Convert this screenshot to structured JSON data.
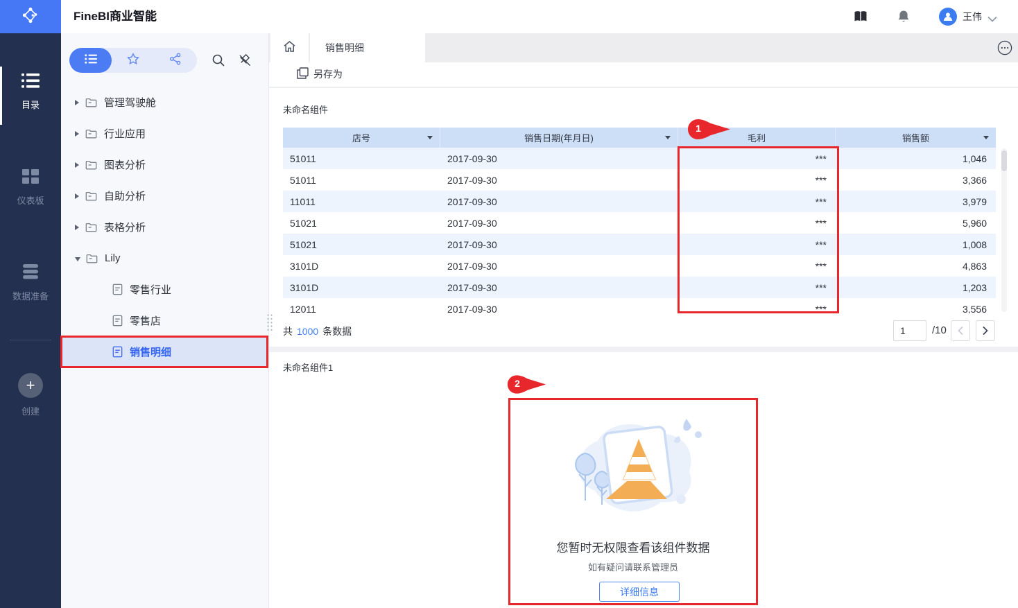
{
  "app": {
    "title": "FineBI商业智能",
    "user_name": "王伟"
  },
  "nav_rail": {
    "items": [
      {
        "label": "目录",
        "icon": "list-icon",
        "active": true
      },
      {
        "label": "仪表板",
        "icon": "dashboard-icon",
        "active": false
      },
      {
        "label": "数据准备",
        "icon": "database-icon",
        "active": false
      },
      {
        "label": "创建",
        "icon": "plus-icon",
        "active": false
      }
    ]
  },
  "sidebar": {
    "view_switch": [
      {
        "icon": "list-icon",
        "active": true
      },
      {
        "icon": "star-icon",
        "active": false
      },
      {
        "icon": "share-icon",
        "active": false
      }
    ],
    "tools": [
      {
        "icon": "search-icon"
      },
      {
        "icon": "unpin-icon"
      }
    ],
    "tree": [
      {
        "label": "管理驾驶舱",
        "type": "folder",
        "level": 0,
        "expanded": false,
        "selected": false
      },
      {
        "label": "行业应用",
        "type": "folder",
        "level": 0,
        "expanded": false,
        "selected": false
      },
      {
        "label": "图表分析",
        "type": "folder",
        "level": 0,
        "expanded": false,
        "selected": false
      },
      {
        "label": "自助分析",
        "type": "folder",
        "level": 0,
        "expanded": false,
        "selected": false
      },
      {
        "label": "表格分析",
        "type": "folder",
        "level": 0,
        "expanded": false,
        "selected": false
      },
      {
        "label": "Lily",
        "type": "folder",
        "level": 0,
        "expanded": true,
        "selected": false
      },
      {
        "label": "零售行业",
        "type": "doc",
        "level": 1,
        "expanded": false,
        "selected": false
      },
      {
        "label": "零售店",
        "type": "doc",
        "level": 1,
        "expanded": false,
        "selected": false
      },
      {
        "label": "销售明细",
        "type": "doc",
        "level": 1,
        "expanded": false,
        "selected": true
      }
    ]
  },
  "tabs": {
    "active_label": "销售明细"
  },
  "toolbar": {
    "save_as_label": "另存为"
  },
  "component1": {
    "title": "未命名组件",
    "table": {
      "columns": [
        {
          "label": "店号",
          "align": "left",
          "filter_arrow": true
        },
        {
          "label": "销售日期(年月日)",
          "align": "left",
          "filter_arrow": true
        },
        {
          "label": "毛利",
          "align": "right",
          "filter_arrow": false
        },
        {
          "label": "销售额",
          "align": "right",
          "filter_arrow": true
        }
      ],
      "rows": [
        [
          "51011",
          "2017-09-30",
          "***",
          "1,046"
        ],
        [
          "51011",
          "2017-09-30",
          "***",
          "3,366"
        ],
        [
          "11011",
          "2017-09-30",
          "***",
          "3,979"
        ],
        [
          "51021",
          "2017-09-30",
          "***",
          "5,960"
        ],
        [
          "51021",
          "2017-09-30",
          "***",
          "1,008"
        ],
        [
          "3101D",
          "2017-09-30",
          "***",
          "4,863"
        ],
        [
          "3101D",
          "2017-09-30",
          "***",
          "1,203"
        ],
        [
          "12011",
          "2017-09-30",
          "***",
          "3,556"
        ]
      ]
    },
    "pagination": {
      "total_prefix": "共",
      "total_count": "1000",
      "total_suffix": "条数据",
      "page_value": "1",
      "page_total": "/10"
    }
  },
  "component2": {
    "title": "未命名组件1",
    "no_permission": {
      "message": "您暂时无权限查看该组件数据",
      "hint": "如有疑问请联系管理员",
      "button_label": "详细信息"
    }
  },
  "annotations": {
    "marker1": "1",
    "marker2": "2",
    "highlight_color": "#e8272c"
  },
  "colors": {
    "accent_blue": "#4b7cf4",
    "rail_bg": "#24304f",
    "table_header_bg": "#cddff7",
    "row_alt_bg": "#edf4fd"
  }
}
